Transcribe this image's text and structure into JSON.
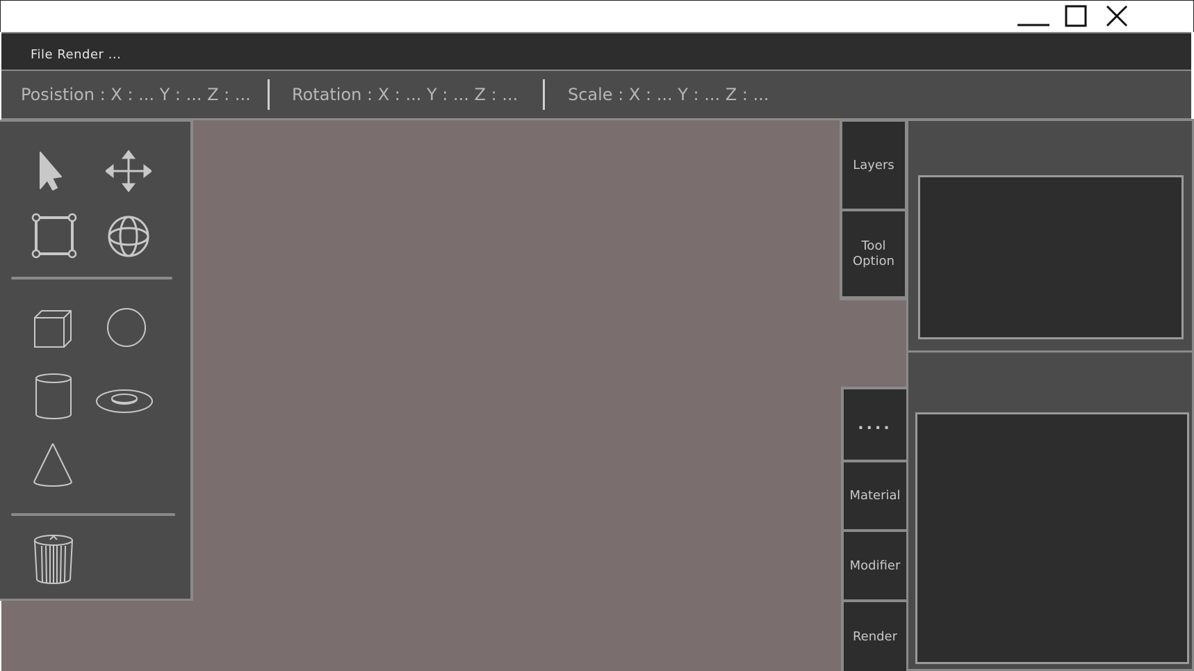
{
  "window": {
    "controls": [
      {
        "name": "minimize-icon"
      },
      {
        "name": "maximize-icon"
      },
      {
        "name": "close-icon"
      }
    ]
  },
  "menu": {
    "label": "File  Render  ..."
  },
  "transform": {
    "position": "Posistion : X : ... Y : ... Z : ...",
    "rotation": "Rotation : X : ... Y : ... Z : ...",
    "scale": "Scale : X : ... Y : ... Z : ..."
  },
  "tools": {
    "transform_tools": [
      "select-arrow-icon",
      "move-icon",
      "scale-box-icon",
      "rotate-globe-icon"
    ],
    "primitives": [
      "cube-icon",
      "sphere-icon",
      "cylinder-icon",
      "torus-icon",
      "cone-icon"
    ],
    "delete": "trash-icon"
  },
  "top_tabs": {
    "layers": "Layers",
    "tool_option": "Tool\nOption"
  },
  "bottom_tabs": {
    "more": "....",
    "material": "Material",
    "modifier": "Modifier",
    "render": "Render"
  },
  "colors": {
    "menubar": "#2d2d2d",
    "panel": "#4b4b4b",
    "viewport": "#7b6e6e",
    "border": "#8a8a8a",
    "text": "#c8c8c8"
  }
}
